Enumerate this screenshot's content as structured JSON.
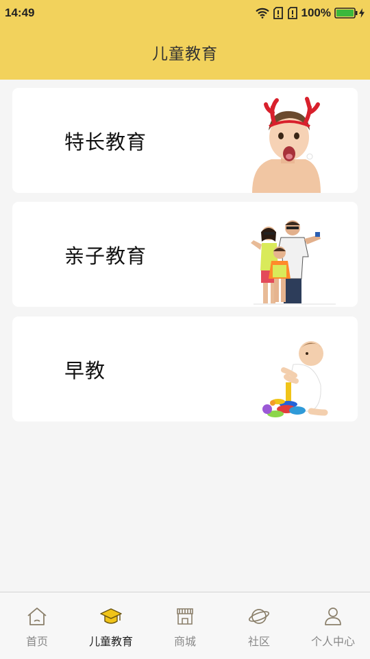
{
  "status_bar": {
    "time": "14:49",
    "battery_percent": "100%",
    "icons": [
      "wifi-icon",
      "sim-no-signal-icon",
      "sim-no-signal-icon",
      "battery-icon",
      "charging-icon"
    ]
  },
  "header": {
    "title": "儿童教育"
  },
  "cards": [
    {
      "label": "特长教育",
      "image": "kid-reindeer-antlers-photo"
    },
    {
      "label": "亲子教育",
      "image": "family-sportswear-photo"
    },
    {
      "label": "早教",
      "image": "baby-stacking-rings-photo"
    }
  ],
  "tabbar": {
    "items": [
      {
        "label": "首页",
        "icon": "home-icon",
        "active": false
      },
      {
        "label": "儿童教育",
        "icon": "graduation-cap-icon",
        "active": true
      },
      {
        "label": "商城",
        "icon": "store-icon",
        "active": false
      },
      {
        "label": "社区",
        "icon": "planet-icon",
        "active": false
      },
      {
        "label": "个人中心",
        "icon": "person-icon",
        "active": false
      }
    ]
  },
  "colors": {
    "accent": "#f2d25c",
    "active_icon": "#f0c419",
    "background": "#f5f5f5",
    "inactive_text": "#888888"
  }
}
